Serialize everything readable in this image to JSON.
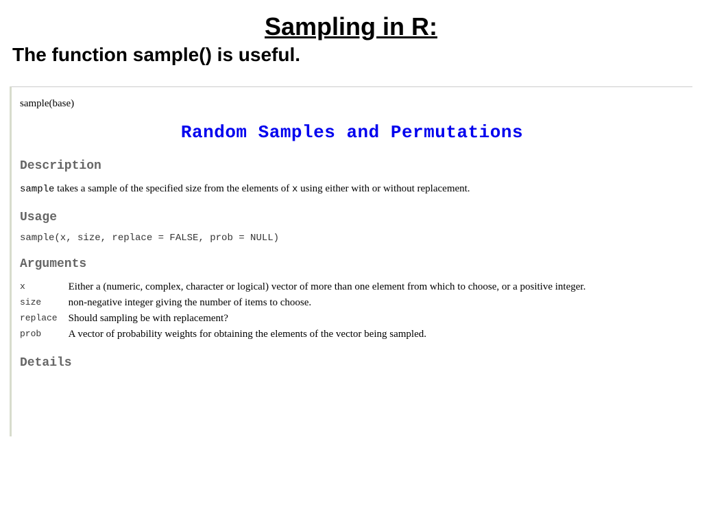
{
  "slide": {
    "title": "Sampling in R:",
    "subtitle": "The function sample() is useful."
  },
  "doc": {
    "pkg_header": "sample(base)",
    "title": "Random Samples and Permutations",
    "headings": {
      "description": "Description",
      "usage": "Usage",
      "arguments": "Arguments",
      "details": "Details"
    },
    "description_pre": "sample",
    "description_text": " takes a sample of the specified size from the elements of ",
    "description_mid": "x",
    "description_post": " using either with or without replacement.",
    "usage_code": "sample(x, size, replace = FALSE, prob = NULL)",
    "args": [
      {
        "name": "x",
        "desc": "Either a (numeric, complex, character or logical) vector of more than one element from which to choose, or a positive integer."
      },
      {
        "name": "size",
        "desc": "non-negative integer giving the number of items to choose."
      },
      {
        "name": "replace",
        "desc": "Should sampling be with replacement?"
      },
      {
        "name": "prob",
        "desc": "A vector of probability weights for obtaining the elements of the vector being sampled."
      }
    ]
  }
}
